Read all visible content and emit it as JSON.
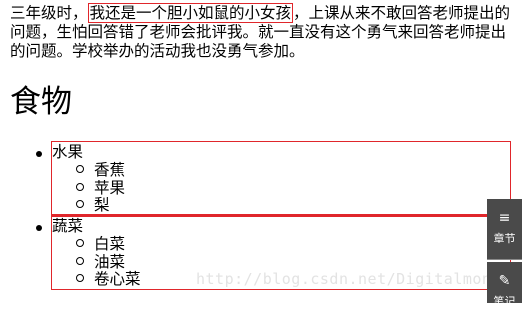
{
  "paragraph": {
    "before": "三年级时，",
    "highlight": "我还是一个胆小如鼠的小女孩",
    "after": "，上课从来不敢回答老师提出的问题，生怕回答错了老师会批评我。就一直没有这个勇气来回答老师提出的问题。学校举办的活动我也没勇气参加。"
  },
  "heading": "食物",
  "categories": [
    {
      "label": "水果",
      "items": [
        "香蕉",
        "苹果",
        "梨"
      ]
    },
    {
      "label": "蔬菜",
      "items": [
        "白菜",
        "油菜",
        "卷心菜"
      ]
    }
  ],
  "watermark": "http://blog.csdn.net/Digitalmon",
  "side_tools": {
    "toc": {
      "icon": "≡",
      "label": "章节"
    },
    "notes": {
      "icon": "✎",
      "label": "笔记"
    }
  },
  "colors": {
    "highlight_border": "#e0262b",
    "side_button_bg": "#4a4a4a"
  }
}
